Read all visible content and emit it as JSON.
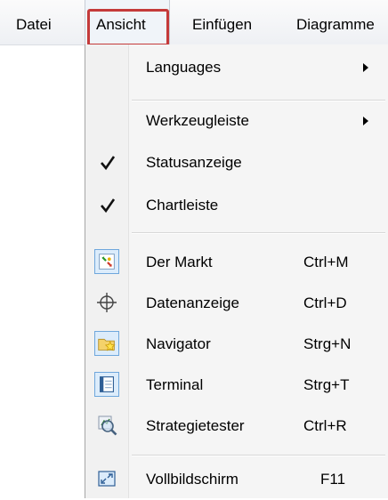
{
  "menubar": {
    "items": [
      {
        "label": "Datei"
      },
      {
        "label": "Ansicht"
      },
      {
        "label": "Einfügen"
      },
      {
        "label": "Diagramme"
      }
    ]
  },
  "view_menu": {
    "items": [
      {
        "label": "Languages",
        "submenu": true
      },
      {
        "label": "Werkzeugleiste",
        "submenu": true
      },
      {
        "label": "Statusanzeige",
        "checked": true
      },
      {
        "label": "Chartleiste",
        "checked": true
      },
      {
        "label": "Der Markt",
        "shortcut": "Ctrl+M",
        "icon": "market-watch-icon"
      },
      {
        "label": "Datenanzeige",
        "shortcut": "Ctrl+D",
        "icon": "crosshair-icon"
      },
      {
        "label": "Navigator",
        "shortcut": "Strg+N",
        "icon": "navigator-folder-star-icon"
      },
      {
        "label": "Terminal",
        "shortcut": "Strg+T",
        "icon": "terminal-window-icon"
      },
      {
        "label": "Strategietester",
        "shortcut": "Ctrl+R",
        "icon": "strategy-tester-magnifier-icon"
      },
      {
        "label": "Vollbildschirm",
        "shortcut": "F11",
        "icon": "fullscreen-icon"
      }
    ]
  },
  "colors": {
    "highlight_border": "#c43a3a",
    "icon_frame": "#6fa7dc"
  }
}
